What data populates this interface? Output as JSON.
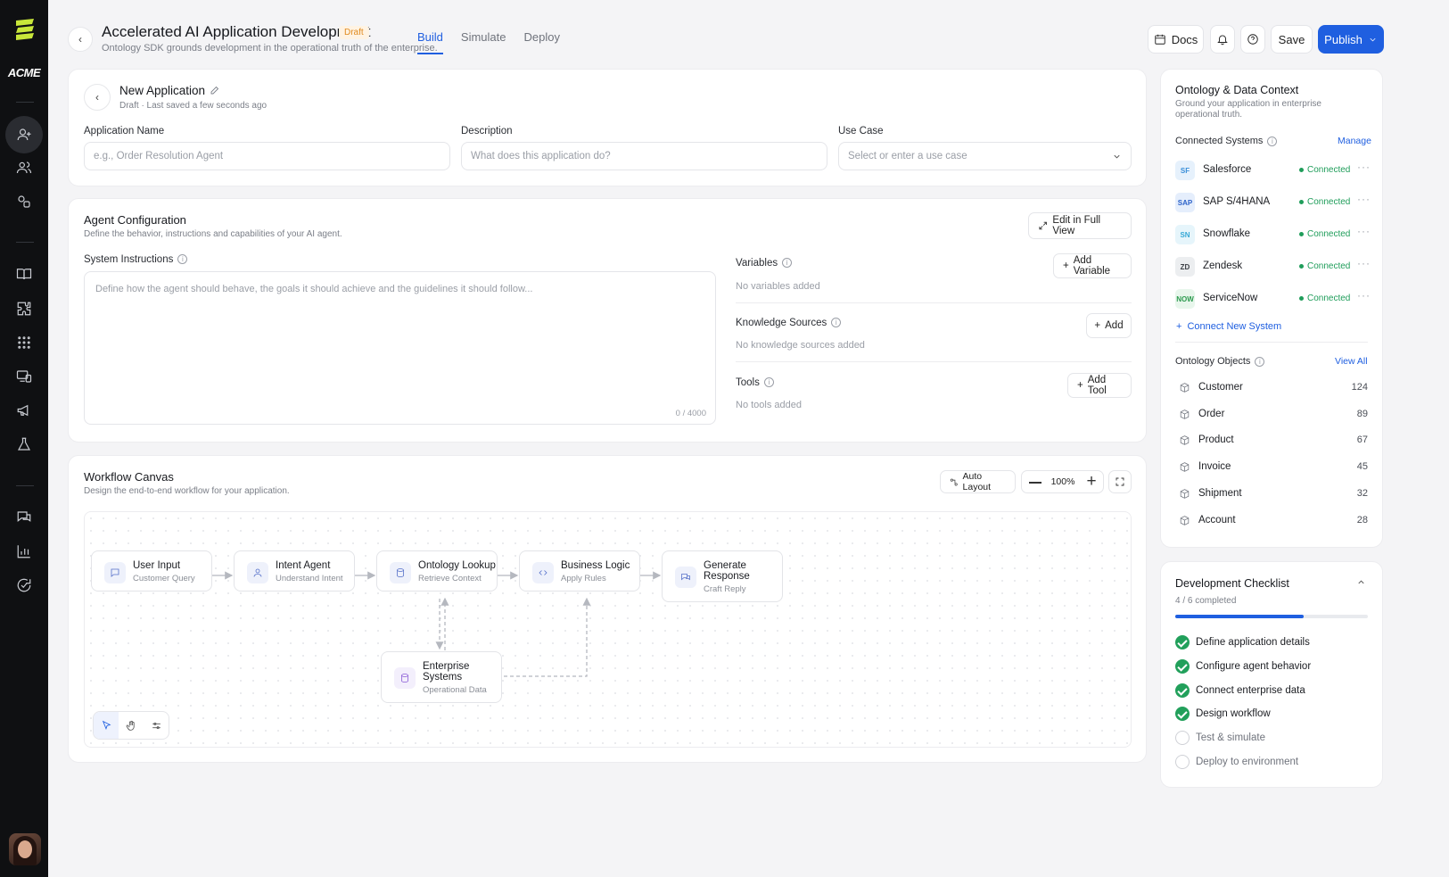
{
  "brand": {
    "name": "ACME"
  },
  "header": {
    "title": "Accelerated AI Application Development",
    "badge": "Draft",
    "subtitle": "Ontology SDK grounds development in the operational truth of the enterprise.",
    "tabs": [
      "Build",
      "Simulate",
      "Deploy"
    ],
    "active_tab": "Build",
    "docs_label": "Docs",
    "save_label": "Save",
    "publish_label": "Publish"
  },
  "app": {
    "name": "New Application",
    "meta": "Draft · Last saved a few seconds ago",
    "fields": {
      "name_label": "Application Name",
      "name_placeholder": "e.g., Order Resolution Agent",
      "desc_label": "Description",
      "desc_placeholder": "What does this application do?",
      "usecase_label": "Use Case",
      "usecase_placeholder": "Select or enter a use case"
    }
  },
  "agent": {
    "title": "Agent Configuration",
    "subtitle": "Define the behavior, instructions and capabilities of your AI agent.",
    "edit_full_view": "Edit in Full View",
    "instructions_label": "System Instructions",
    "instructions_placeholder": "Define how the agent should behave, the goals it should achieve and the guidelines it should follow...",
    "char_count": "0 / 4000",
    "variables": {
      "label": "Variables",
      "button": "Add Variable",
      "empty": "No variables added"
    },
    "knowledge": {
      "label": "Knowledge Sources",
      "button": "Add",
      "empty": "No knowledge sources added"
    },
    "tools": {
      "label": "Tools",
      "button": "Add Tool",
      "empty": "No tools added"
    }
  },
  "workflow": {
    "title": "Workflow Canvas",
    "subtitle": "Design the end-to-end workflow for your application.",
    "auto_layout": "Auto Layout",
    "zoom": "100%",
    "nodes": [
      {
        "title": "User Input",
        "sub": "Customer Query"
      },
      {
        "title": "Intent Agent",
        "sub": "Understand Intent"
      },
      {
        "title": "Ontology Lookup",
        "sub": "Retrieve Context"
      },
      {
        "title": "Business Logic",
        "sub": "Apply Rules"
      },
      {
        "title": "Generate Response",
        "sub": "Craft Reply"
      },
      {
        "title": "Enterprise Systems",
        "sub": "Operational Data"
      }
    ]
  },
  "ontology": {
    "title": "Ontology & Data Context",
    "subtitle": "Ground your application in enterprise operational truth.",
    "connected_label": "Connected Systems",
    "manage": "Manage",
    "systems": [
      {
        "abbr": "SF",
        "name": "Salesforce",
        "status": "Connected",
        "bg": "#e6f1fc",
        "fg": "#3a8fd9"
      },
      {
        "abbr": "SAP",
        "name": "SAP S/4HANA",
        "status": "Connected",
        "bg": "#e5eefc",
        "fg": "#2c62c9"
      },
      {
        "abbr": "SN",
        "name": "Snowflake",
        "status": "Connected",
        "bg": "#e6f5fb",
        "fg": "#38a9d6"
      },
      {
        "abbr": "ZD",
        "name": "Zendesk",
        "status": "Connected",
        "bg": "#eceef0",
        "fg": "#3b3f45"
      },
      {
        "abbr": "NOW",
        "name": "ServiceNow",
        "status": "Connected",
        "bg": "#e8f6ec",
        "fg": "#2c9a4e"
      }
    ],
    "connect_new": "Connect New System",
    "objects_label": "Ontology Objects",
    "view_all": "View All",
    "objects": [
      {
        "name": "Customer",
        "count": "124"
      },
      {
        "name": "Order",
        "count": "89"
      },
      {
        "name": "Product",
        "count": "67"
      },
      {
        "name": "Invoice",
        "count": "45"
      },
      {
        "name": "Shipment",
        "count": "32"
      },
      {
        "name": "Account",
        "count": "28"
      }
    ]
  },
  "checklist": {
    "title": "Development Checklist",
    "progress_text": "4 / 6 completed",
    "progress": 0.667,
    "items": [
      {
        "label": "Define application details",
        "done": true
      },
      {
        "label": "Configure agent behavior",
        "done": true
      },
      {
        "label": "Connect enterprise data",
        "done": true
      },
      {
        "label": "Design workflow",
        "done": true
      },
      {
        "label": "Test & simulate",
        "done": false
      },
      {
        "label": "Deploy to environment",
        "done": false
      }
    ]
  },
  "colors": {
    "accent": "#1f5fe0",
    "success": "#22a05b",
    "rail": "#0f1012",
    "draft": "#e08a1e"
  }
}
